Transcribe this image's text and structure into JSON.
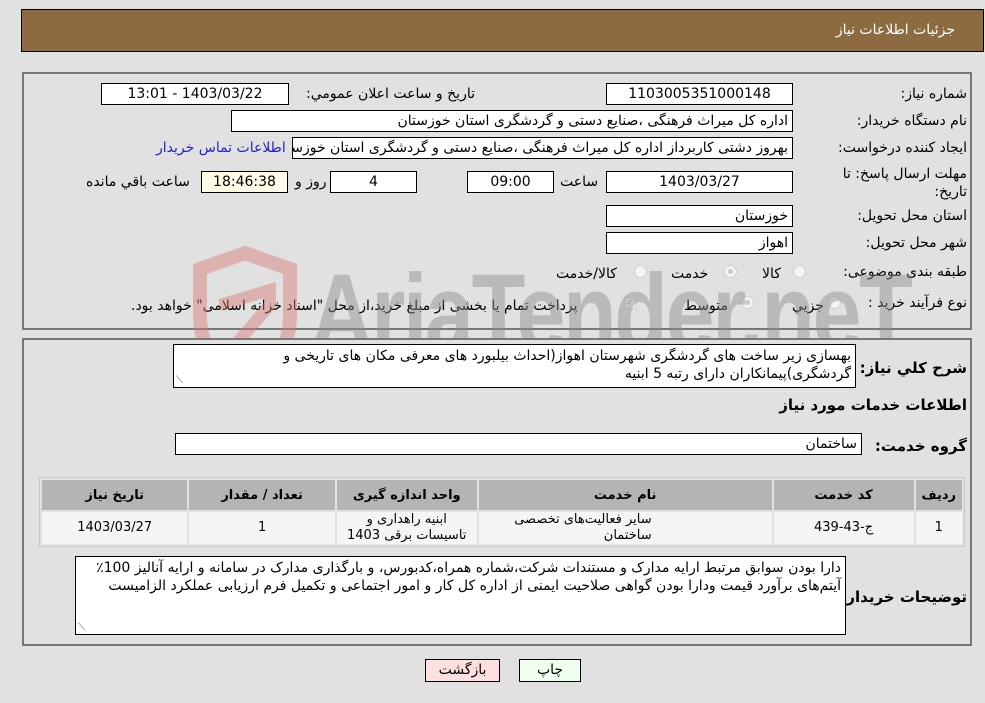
{
  "header": {
    "title": "جزئيات اطلاعات نیاز"
  },
  "form": {
    "need_number": {
      "label": "شماره نیاز:",
      "value": "1103005351000148"
    },
    "announce_datetime": {
      "label": "تاريخ و ساعت اعلان عمومي:",
      "value": "1403/03/22 - 13:01"
    },
    "buyer_org": {
      "label": "نام دستگاه خريدار:",
      "value": "اداره کل میراث فرهنگی ،صنایع دستی و گردشگری استان خوزستان"
    },
    "requester": {
      "label": "ايجاد كننده درخواست:",
      "value": "بهروز دشتی کاربرداز اداره کل میراث فرهنگی ،صنایع دستی و گردشگری استان خوزستان",
      "contact_link": "اطلاعات تماس خريدار"
    },
    "deadline": {
      "label": "مهلت ارسال پاسخ: تا تاريخ:",
      "date": "1403/03/27",
      "time_label": "ساعت",
      "time": "09:00",
      "days": "4",
      "days_label": "روز و",
      "remaining": "18:46:38",
      "remaining_label": "ساعت باقي مانده"
    },
    "province": {
      "label": "استان محل تحويل:",
      "value": "خوزستان"
    },
    "city": {
      "label": "شهر محل تحويل:",
      "value": "اهواز"
    },
    "category": {
      "label": "طبقه بندی موضوعی:",
      "options": [
        "کالا",
        "خدمت",
        "کالا/خدمت"
      ],
      "selected": "خدمت"
    },
    "purchase_type": {
      "label": "نوع فرآيند خريد :",
      "options": [
        "جزيي",
        "متوسط"
      ],
      "selected": "متوسط",
      "treasury_note": "پرداخت تمام يا بخشی از مبلغ خريد،از محل \"اسناد خزانه اسلامی\" خواهد بود."
    }
  },
  "description": {
    "label": "شرح كلي نياز:",
    "value": "بهسازی  زیر ساخت های گردشگری شهرستان اهواز(احداث بیلبورد های معرفی مکان های تاریخی و گردشگری)پیمانکاران دارای  رتبه 5 ابنیه"
  },
  "services": {
    "section_title": "اطلاعات خدمات مورد نياز",
    "group_label": "گروه خدمت:",
    "group_value": "ساختمان",
    "columns": [
      "رديف",
      "كد خدمت",
      "نام خدمت",
      "واحد اندازه گيری",
      "تعداد / مقدار",
      "تاريخ نياز"
    ],
    "rows": [
      {
        "index": "1",
        "code": "ج-43-439",
        "name": "سایر فعالیت‌های تخصصی ساختمان",
        "unit": "ابنیه راهداری و تاسیسات برقی 1403",
        "qty": "1",
        "date": "1403/03/27"
      }
    ]
  },
  "buyer_notes": {
    "label": "توضيحات خريدار:",
    "value": " دارا بودن سوابق مرتبط  ارایه مدارک و مستندات شرکت،شماره همراه،کدبورس، و بارگذاری مدارک در سامانه و ارایه آنالیز 100٪ آیتم‌های برآورد قیمت ودارا بودن گواهی صلاحیت ایمنی از اداره کل کار و امور اجتماعی  و تکمیل فرم ارزیابی عملکرد الزامیست"
  },
  "buttons": {
    "print": "چاپ",
    "back": "بازگشت"
  },
  "watermark": "AriaTender.neT"
}
